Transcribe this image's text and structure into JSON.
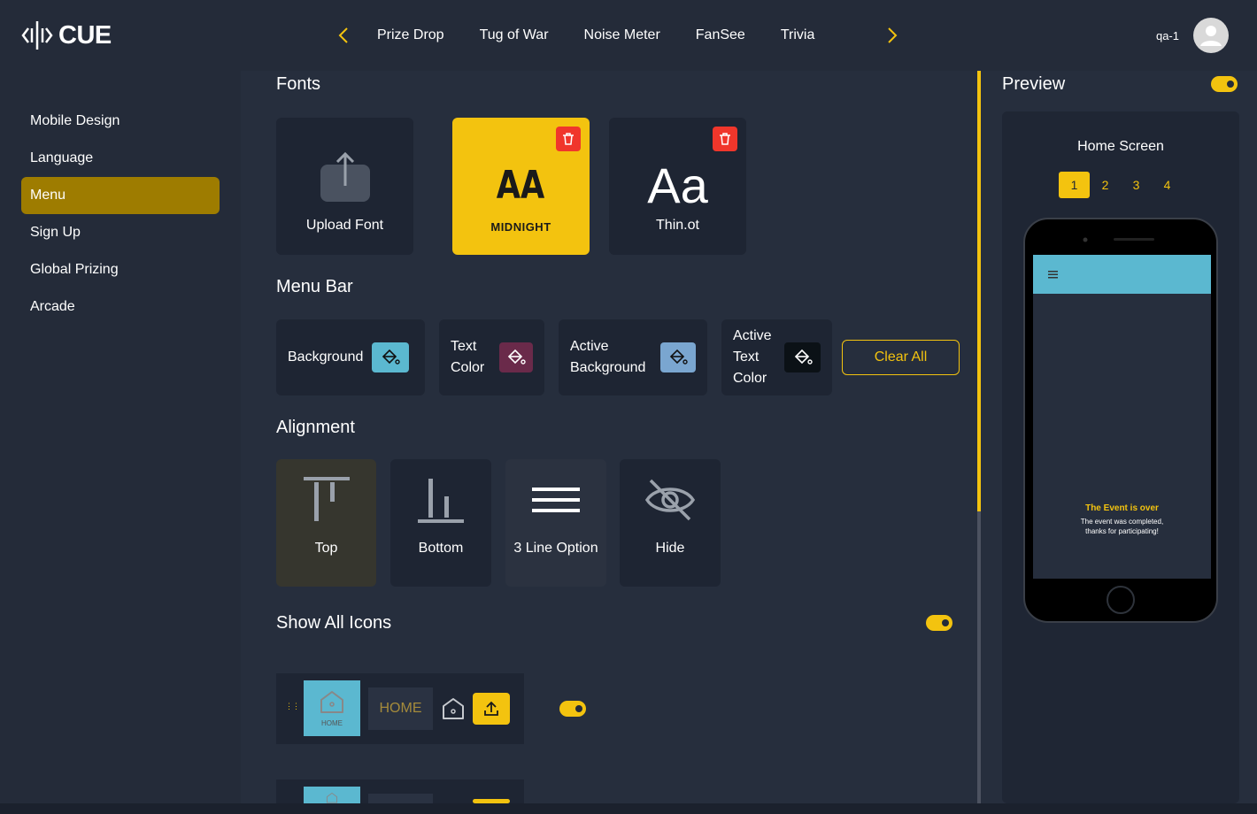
{
  "app": {
    "logo_text": "CUE"
  },
  "nav": {
    "tabs": [
      "Prize Drop",
      "Tug of War",
      "Noise Meter",
      "FanSee",
      "Trivia"
    ]
  },
  "user": {
    "name": "qa-1"
  },
  "sidebar": {
    "items": [
      {
        "label": "Mobile Design",
        "active": false
      },
      {
        "label": "Language",
        "active": false
      },
      {
        "label": "Menu",
        "active": true
      },
      {
        "label": "Sign Up",
        "active": false
      },
      {
        "label": "Global Prizing",
        "active": false
      },
      {
        "label": "Arcade",
        "active": false
      }
    ]
  },
  "fonts": {
    "title": "Fonts",
    "upload_label": "Upload Font",
    "items": [
      {
        "sample": "AA",
        "name": "MIDNIGHT",
        "selected": true
      },
      {
        "sample": "Aa",
        "name": "Thin.ot",
        "selected": false
      }
    ]
  },
  "menu_bar": {
    "title": "Menu Bar",
    "colors": [
      {
        "label": "Background",
        "swatch": "#5bb8d0"
      },
      {
        "label": "Text Color",
        "swatch": "#6a2a4a"
      },
      {
        "label": "Active Background",
        "swatch": "#7aa6d0"
      },
      {
        "label": "Active Text Color",
        "swatch": "#0b1116"
      }
    ],
    "clear_label": "Clear All"
  },
  "alignment": {
    "title": "Alignment",
    "options": [
      {
        "label": "Top",
        "icon": "align-top-icon",
        "active": true
      },
      {
        "label": "Bottom",
        "icon": "align-bottom-icon",
        "active": false
      },
      {
        "label": "3 Line Option",
        "icon": "hamburger-icon",
        "active": false
      },
      {
        "label": "Hide",
        "icon": "eye-off-icon",
        "active": false
      }
    ]
  },
  "icons": {
    "title": "Show All Icons",
    "show_all": true,
    "rows": [
      {
        "preview_label": "HOME",
        "text": "HOME",
        "enabled": true
      }
    ]
  },
  "preview": {
    "title": "Preview",
    "enabled": true,
    "screen_label": "Home Screen",
    "pages": [
      "1",
      "2",
      "3",
      "4"
    ],
    "active_page": "1",
    "message_title": "The Event is over",
    "message_body": "The event was completed, thanks for participating!"
  },
  "colors": {
    "accent": "#f3c30f",
    "danger": "#f0362b",
    "panel": "#1e2533",
    "background": "#262e3d"
  }
}
